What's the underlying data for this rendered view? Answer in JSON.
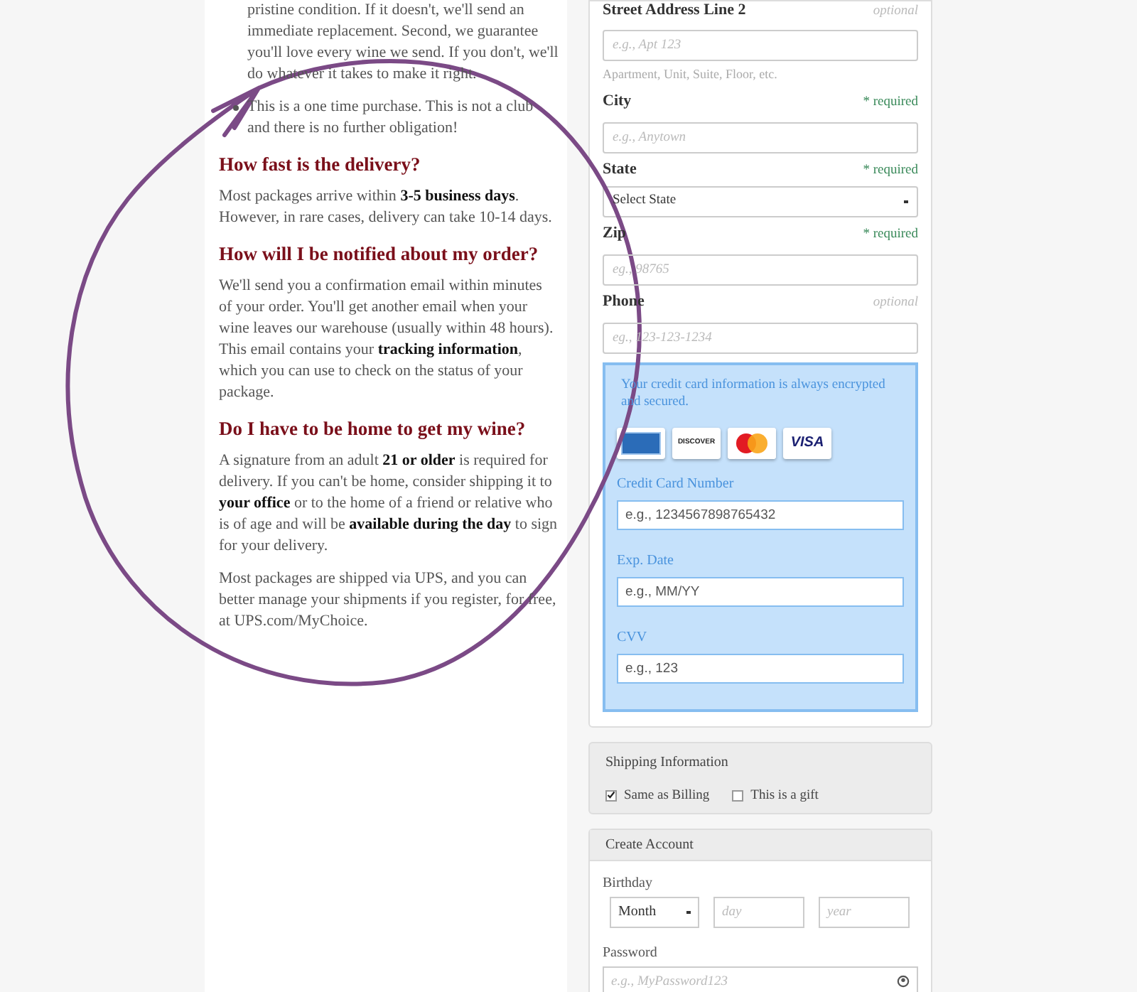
{
  "faq": {
    "lead_paragraph": "pristine condition. If it doesn't, we'll send an immediate replacement. Second, we guarantee you'll love every wine we send. If you don't, we'll do whatever it takes to make it right.",
    "bullets": [
      "This is a one time purchase. This is not a club and there is no further obligation!"
    ],
    "sections": [
      {
        "heading": "How fast is the delivery?",
        "paragraphs": [
          "Most packages arrive within **3-5 business days**. However, in rare cases, delivery can take 10-14 days."
        ]
      },
      {
        "heading": "How will I be notified about my order?",
        "paragraphs": [
          "We'll send you a confirmation email within minutes of your order. You'll get another email when your wine leaves our warehouse (usually within 48 hours). This email contains your **tracking information**, which you can use to check on the status of your package."
        ]
      },
      {
        "heading": "Do I have to be home to get my wine?",
        "paragraphs": [
          "A signature from an adult **21 or older** is required for delivery. If you can't be home, consider shipping it to **your office** or to the home of a friend or relative who is of age and will be **available during the day** to sign for your delivery.",
          "Most packages are shipped via UPS, and you can better manage your shipments if you register, for free, at UPS.com/MyChoice."
        ]
      }
    ]
  },
  "address_fields": [
    {
      "kind": "input",
      "label": "Street Address Line 2",
      "note": "optional",
      "required": false,
      "placeholder": "e.g., Apt 123",
      "help": "Apartment, Unit, Suite, Floor, etc."
    },
    {
      "kind": "input",
      "label": "City",
      "note": "* required",
      "required": true,
      "placeholder": "e.g., Anytown"
    },
    {
      "kind": "select",
      "label": "State",
      "note": "* required",
      "required": true,
      "value": "Select State"
    },
    {
      "kind": "input",
      "label": "Zip",
      "note": "* required",
      "required": true,
      "placeholder": "eg., 98765"
    },
    {
      "kind": "input",
      "label": "Phone",
      "note": "optional",
      "required": false,
      "placeholder": "eg., 123-123-1234"
    }
  ],
  "payment": {
    "secure_note": "Your credit card information is always encrypted and secured.",
    "cards": [
      {
        "kind": "amex"
      },
      {
        "kind": "discover",
        "label": "DISCOVER"
      },
      {
        "kind": "mastercard"
      },
      {
        "kind": "visa",
        "label": "VISA"
      }
    ],
    "fields": [
      {
        "label": "Credit Card Number",
        "placeholder": "e.g., 1234567898765432"
      },
      {
        "label": "Exp. Date",
        "placeholder": "e.g., MM/YY"
      },
      {
        "label": "CVV",
        "placeholder": "e.g., 123"
      }
    ]
  },
  "shipping": {
    "title": "Shipping Information",
    "options": [
      {
        "label": "Same as Billing",
        "checked": true
      },
      {
        "label": "This is a gift",
        "checked": false
      }
    ]
  },
  "account": {
    "title": "Create Account",
    "birthday": {
      "label": "Birthday",
      "month": "Month",
      "day_placeholder": "day",
      "year_placeholder": "year"
    },
    "password": {
      "label": "Password",
      "placeholder": "e.g., MyPassword123"
    }
  }
}
